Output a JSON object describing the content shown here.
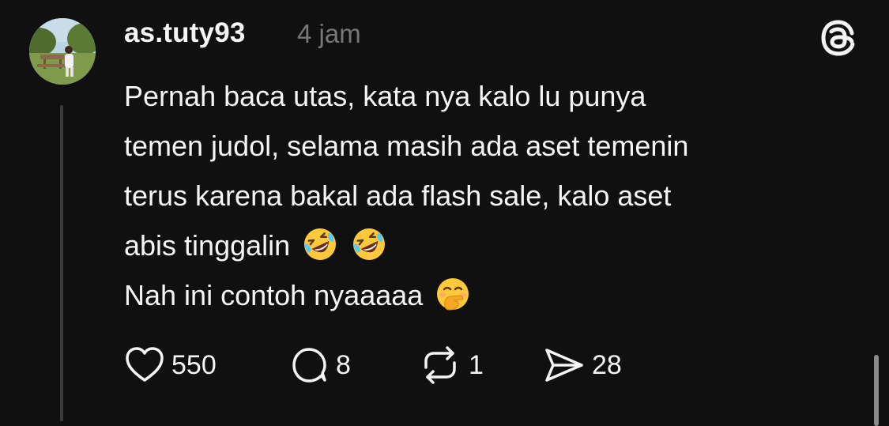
{
  "post": {
    "username": "as.tuty93",
    "timestamp": "4 jam",
    "lines": [
      "Pernah baca utas, kata nya kalo lu punya",
      "temen judol, selama masih ada aset temenin",
      "terus karena bakal ada flash sale, kalo aset",
      "abis tinggalin",
      "Nah ini contoh nyaaaaa"
    ]
  },
  "actions": {
    "likes": "550",
    "replies": "8",
    "reposts": "1",
    "shares": "28"
  },
  "icons": {
    "app_logo": "threads-logo-icon",
    "like": "heart-icon",
    "reply": "speech-bubble-icon",
    "repost": "repost-icon",
    "share": "send-icon",
    "emoji_1": "rolling-on-floor-laughing-icon",
    "emoji_2": "rolling-on-floor-laughing-icon",
    "emoji_3": "face-with-hand-over-mouth-icon"
  },
  "colors": {
    "background": "#101010",
    "text": "#f3f5f7",
    "muted": "#777777"
  }
}
